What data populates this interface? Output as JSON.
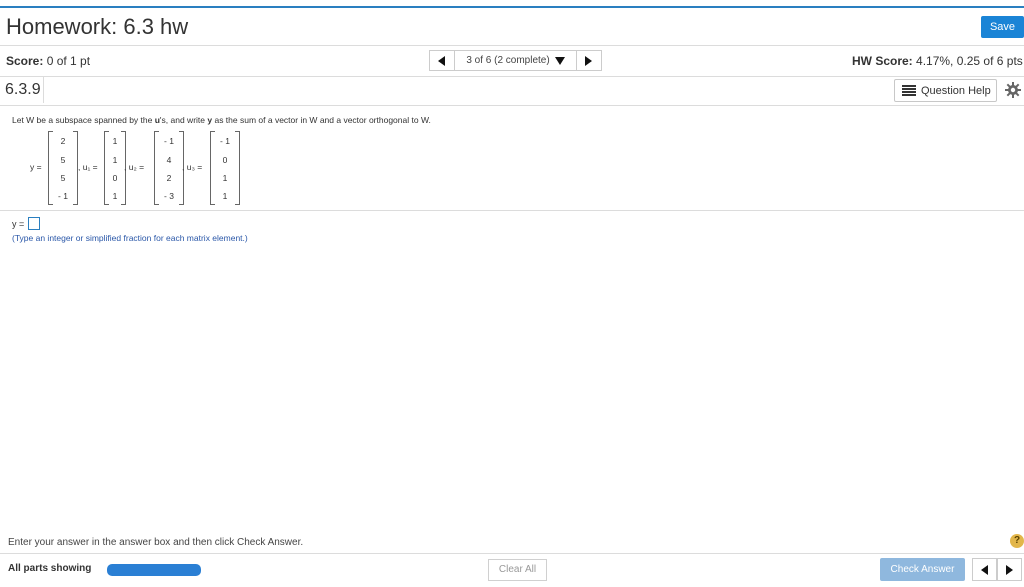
{
  "header": {
    "title": "Homework: 6.3 hw",
    "save_label": "Save"
  },
  "score_bar": {
    "score_label": "Score:",
    "score_value": "0 of 1 pt",
    "nav_text": "3 of 6 (2 complete)",
    "hw_score_label": "HW Score:",
    "hw_score_value": "4.17%, 0.25 of 6 pts"
  },
  "question_bar": {
    "number": "6.3.9",
    "help_label": "Question Help"
  },
  "problem": {
    "prompt_pre": "Let W be a subspace spanned by the ",
    "prompt_u": "u",
    "prompt_mid": "'s, and write ",
    "prompt_y": "y",
    "prompt_post": " as the sum of a vector in W and a vector orthogonal to W.",
    "vectors": [
      {
        "label": "y =",
        "values": [
          "2",
          "5",
          "5",
          "- 1"
        ]
      },
      {
        "label": ", u₁ =",
        "values": [
          "1",
          "1",
          "0",
          "1"
        ]
      },
      {
        "label": ", u₂ =",
        "values": [
          "- 1",
          "4",
          "2",
          "- 3"
        ]
      },
      {
        "label": ", u₃ =",
        "values": [
          "- 1",
          "0",
          "1",
          "1"
        ]
      }
    ]
  },
  "answer": {
    "label": "y =",
    "hint": "(Type an integer or simplified fraction for each matrix element.)"
  },
  "footer": {
    "message": "Enter your answer in the answer box and then click Check Answer.",
    "help_symbol": "?",
    "parts_label": "All parts showing",
    "progress": 1.0,
    "clear_label": "Clear All",
    "check_label": "Check Answer"
  },
  "colors": {
    "accent": "#1a84d6",
    "progress": "#2a7fd4",
    "check_disabled": "#8fb8de",
    "help_circle": "#e2b64a"
  }
}
